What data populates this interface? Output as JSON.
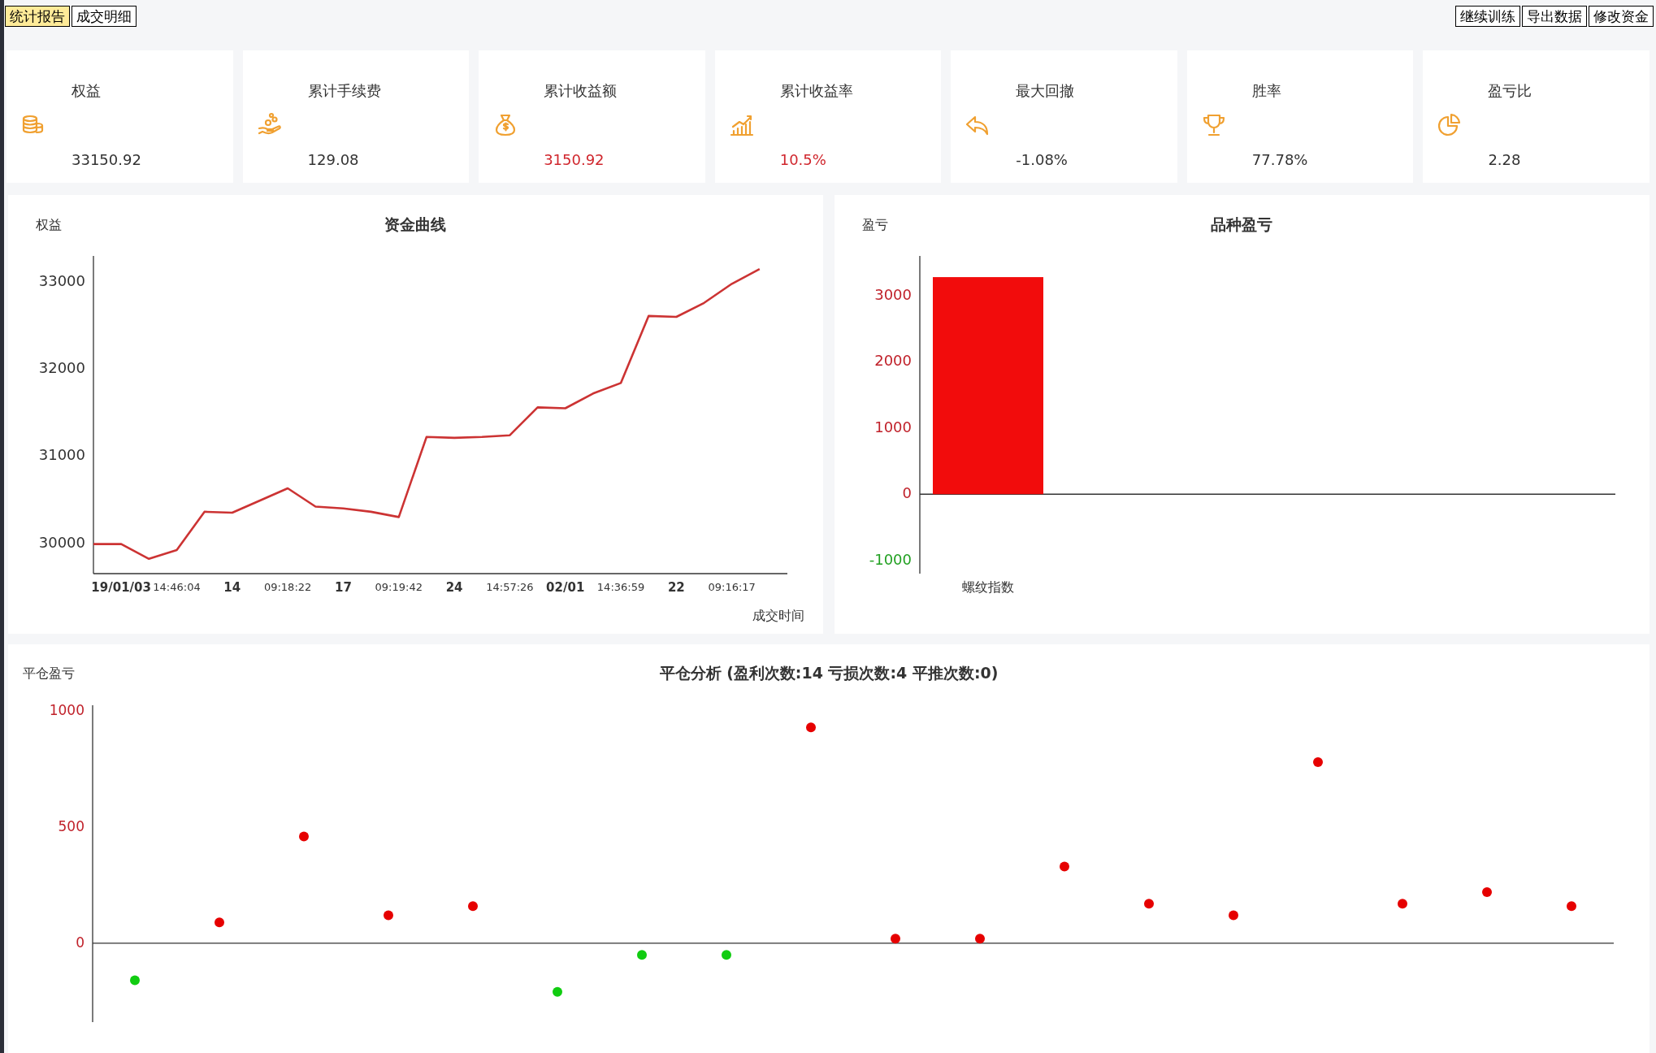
{
  "tabs": [
    {
      "label": "统计报告",
      "selected": true
    },
    {
      "label": "成交明细",
      "selected": false
    }
  ],
  "actions": [
    "继续训练",
    "导出数据",
    "修改资金"
  ],
  "cards": [
    {
      "label": "权益",
      "value": "33150.92",
      "color": "#333333"
    },
    {
      "label": "累计手续费",
      "value": "129.08",
      "color": "#333333"
    },
    {
      "label": "累计收益额",
      "value": "3150.92",
      "color": "#d0262d"
    },
    {
      "label": "累计收益率",
      "value": "10.5%",
      "color": "#d0262d"
    },
    {
      "label": "最大回撤",
      "value": "-1.08%",
      "color": "#333333"
    },
    {
      "label": "胜率",
      "value": "77.78%",
      "color": "#333333"
    },
    {
      "label": "盈亏比",
      "value": "2.28",
      "color": "#333333"
    }
  ],
  "equity_chart": {
    "title": "资金曲线",
    "chart_data": {
      "type": "line",
      "ylabel": "权益",
      "xlabel": "成交时间",
      "categories": [
        null,
        "19/01/03",
        null,
        "14:46:04",
        null,
        "14",
        null,
        "09:18:22",
        null,
        "17",
        null,
        "09:19:42",
        null,
        "24",
        null,
        "14:57:26",
        null,
        "02/01",
        null,
        "14:36:59",
        null,
        "22",
        null,
        "09:16:17",
        null
      ],
      "values": [
        29990,
        29990,
        29820,
        29920,
        30360,
        30350,
        30490,
        30630,
        30420,
        30400,
        30360,
        30300,
        31220,
        31210,
        31220,
        31240,
        31560,
        31550,
        31720,
        31840,
        32610,
        32600,
        32760,
        32980,
        33150
      ],
      "ylim": [
        29650,
        33300
      ],
      "yticks": [
        30000,
        31000,
        32000,
        33000
      ]
    }
  },
  "product_chart": {
    "title": "品种盈亏",
    "chart_data": {
      "type": "bar",
      "ylabel": "盈亏",
      "categories": [
        "螺纹指数"
      ],
      "values": [
        3280
      ],
      "ylim": [
        -1200,
        3600
      ],
      "yticks": [
        -1000,
        0,
        1000,
        2000,
        3000
      ]
    }
  },
  "close_chart": {
    "title": "平仓分析 (盈利次数:14 亏损次数:4 平推次数:0)",
    "chart_data": {
      "type": "scatter",
      "ylabel": "平仓盈亏",
      "categories": [
        null,
        null,
        null,
        null,
        null,
        null,
        null,
        null,
        null,
        null,
        null,
        null,
        null,
        null,
        null,
        null,
        null,
        null
      ],
      "values": [
        -160,
        90,
        460,
        120,
        160,
        -210,
        -50,
        -50,
        930,
        20,
        20,
        330,
        170,
        120,
        780,
        170,
        220,
        160
      ],
      "ylim": [
        -340,
        1025
      ],
      "yticks": [
        0,
        500,
        1000
      ]
    }
  }
}
